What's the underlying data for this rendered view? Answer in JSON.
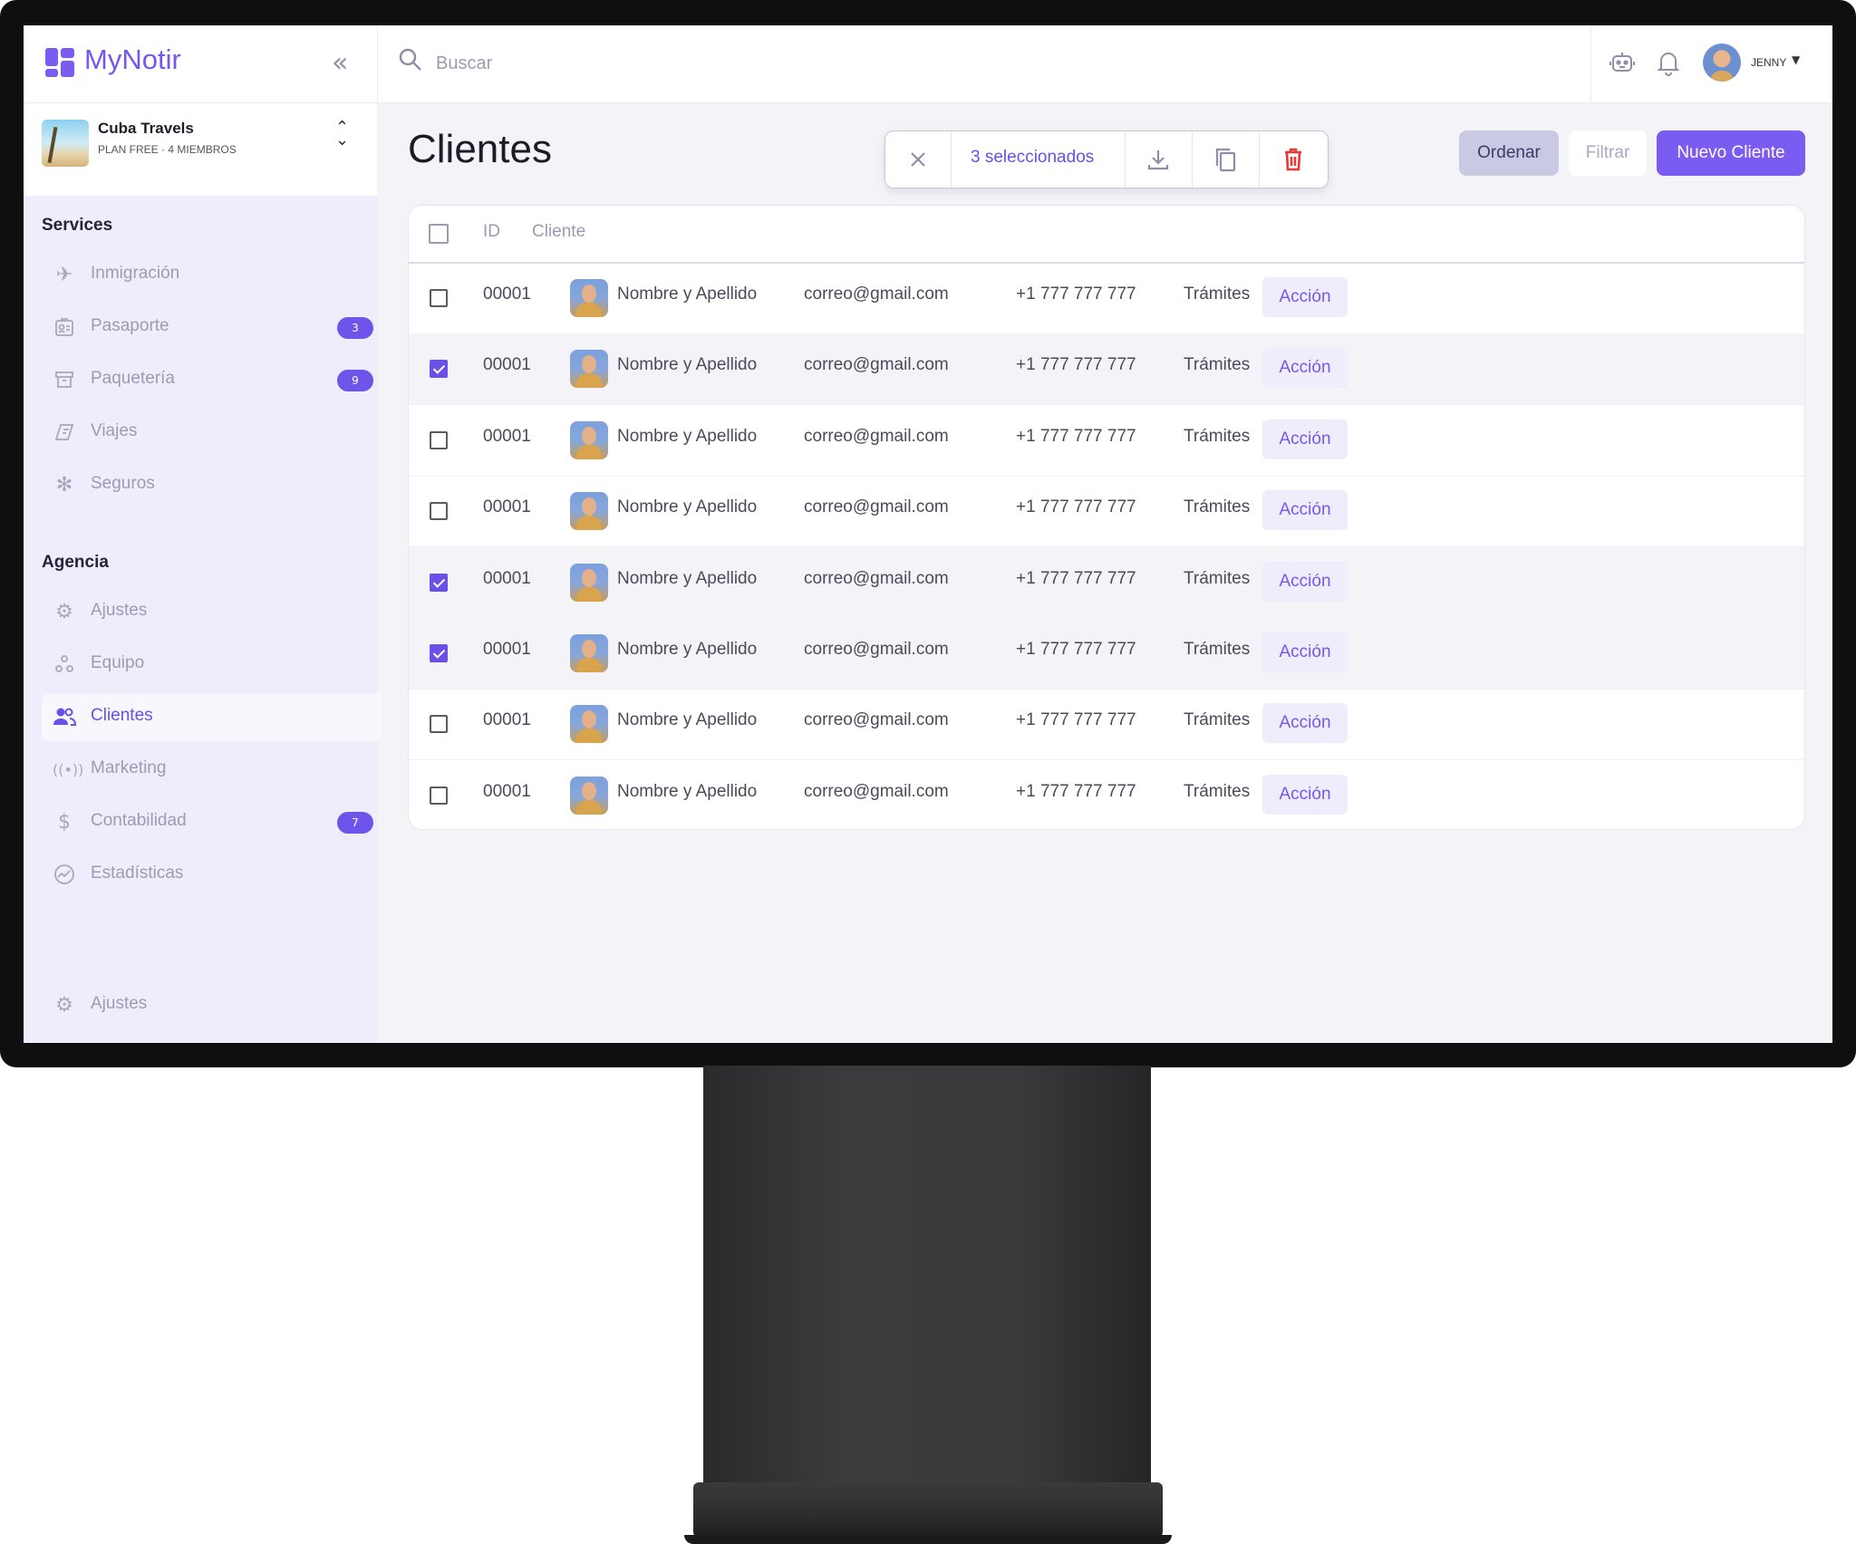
{
  "app": {
    "name": "MyNotir",
    "colors": {
      "accent": "#7b5cf0",
      "sidebar_bg": "#efedfc",
      "danger": "#e53935"
    }
  },
  "workspace": {
    "name": "Cuba Travels",
    "plan": "PLAN FREE · 4 MIEMBROS"
  },
  "sidebar": {
    "services_title": "Services",
    "services": [
      {
        "label": "Inmigración",
        "icon": "plane-icon"
      },
      {
        "label": "Pasaporte",
        "icon": "passport-icon",
        "badge": "3"
      },
      {
        "label": "Paquetería",
        "icon": "package-icon",
        "badge": "9"
      },
      {
        "label": "Viajes",
        "icon": "ticket-icon"
      },
      {
        "label": "Seguros",
        "icon": "asterisk-icon"
      }
    ],
    "agency_title": "Agencia",
    "agency": [
      {
        "label": "Ajustes",
        "icon": "gear-icon"
      },
      {
        "label": "Equipo",
        "icon": "team-icon"
      },
      {
        "label": "Clientes",
        "icon": "users-icon",
        "active": true
      },
      {
        "label": "Marketing",
        "icon": "broadcast-icon"
      },
      {
        "label": "Contabilidad",
        "icon": "dollar-icon",
        "badge": "7"
      },
      {
        "label": "Estadísticas",
        "icon": "chart-icon"
      }
    ],
    "footer_label": "Ajustes"
  },
  "topbar": {
    "search_placeholder": "Buscar",
    "user_name": "JENNY"
  },
  "main": {
    "title": "Clientes",
    "bulk": {
      "selected_text": "3 seleccionados"
    },
    "buttons": {
      "order": "Ordenar",
      "filter": "Filtrar",
      "new_client": "Nuevo Cliente"
    },
    "table": {
      "headers": {
        "id": "ID",
        "client": "Cliente"
      },
      "rows": [
        {
          "checked": false,
          "id": "00001",
          "name": "Nombre y Apellido",
          "email": "correo@gmail.com",
          "phone": "+1 777 777 777",
          "type": "Trámites",
          "action": "Acción"
        },
        {
          "checked": true,
          "id": "00001",
          "name": "Nombre y Apellido",
          "email": "correo@gmail.com",
          "phone": "+1 777 777 777",
          "type": "Trámites",
          "action": "Acción"
        },
        {
          "checked": false,
          "id": "00001",
          "name": "Nombre y Apellido",
          "email": "correo@gmail.com",
          "phone": "+1 777 777 777",
          "type": "Trámites",
          "action": "Acción"
        },
        {
          "checked": false,
          "id": "00001",
          "name": "Nombre y Apellido",
          "email": "correo@gmail.com",
          "phone": "+1 777 777 777",
          "type": "Trámites",
          "action": "Acción"
        },
        {
          "checked": true,
          "id": "00001",
          "name": "Nombre y Apellido",
          "email": "correo@gmail.com",
          "phone": "+1 777 777 777",
          "type": "Trámites",
          "action": "Acción"
        },
        {
          "checked": true,
          "id": "00001",
          "name": "Nombre y Apellido",
          "email": "correo@gmail.com",
          "phone": "+1 777 777 777",
          "type": "Trámites",
          "action": "Acción"
        },
        {
          "checked": false,
          "id": "00001",
          "name": "Nombre y Apellido",
          "email": "correo@gmail.com",
          "phone": "+1 777 777 777",
          "type": "Trámites",
          "action": "Acción"
        },
        {
          "checked": false,
          "id": "00001",
          "name": "Nombre y Apellido",
          "email": "correo@gmail.com",
          "phone": "+1 777 777 777",
          "type": "Trámites",
          "action": "Acción"
        }
      ]
    }
  }
}
